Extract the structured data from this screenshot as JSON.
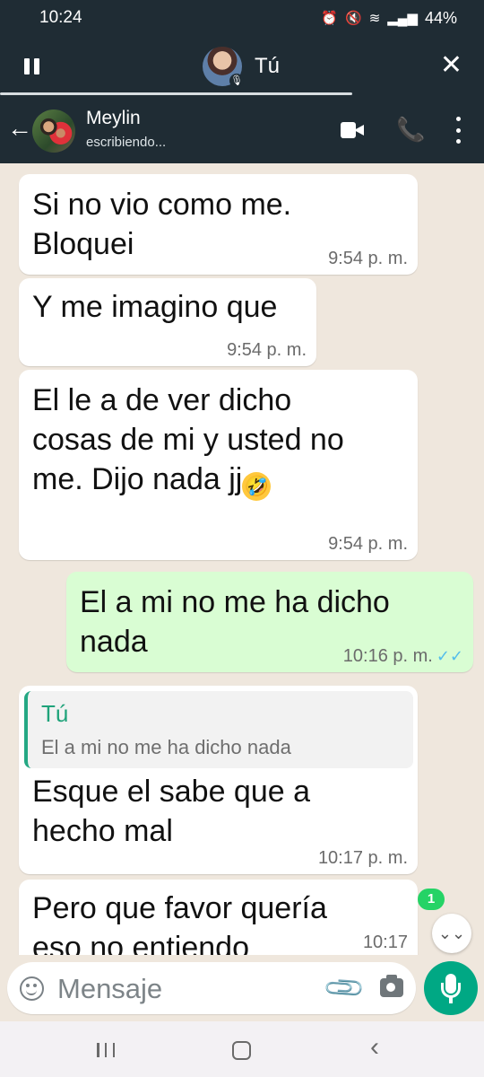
{
  "status_bar": {
    "time": "10:24",
    "icons": [
      "alarm-icon",
      "mute-icon",
      "wifi-icon",
      "signal-icon"
    ],
    "battery": "44%"
  },
  "call_bar": {
    "participant": "Tú",
    "icons": [
      "pause-icon",
      "mic-icon",
      "close-icon"
    ]
  },
  "chat_header": {
    "contact_name": "Meylin",
    "status": "escribiendo...",
    "icons": [
      "back-arrow-icon",
      "video-call-icon",
      "phone-icon",
      "more-menu-icon"
    ]
  },
  "messages": [
    {
      "direction": "in",
      "lines": [
        "Si no vio como me.",
        "Bloquei"
      ],
      "time": "9:54 p. m."
    },
    {
      "direction": "in",
      "lines": [
        "Y me imagino que"
      ],
      "time": "9:54 p. m."
    },
    {
      "direction": "in",
      "lines": [
        "El le a de ver dicho",
        "cosas de mi y usted no",
        "me. Dijo nada jj"
      ],
      "emoji": "🤣",
      "time": "9:54 p. m."
    },
    {
      "direction": "out",
      "lines": [
        "El a mi no me ha dicho",
        "nada"
      ],
      "time": "10:16 p. m.",
      "ticks": "✓✓"
    },
    {
      "direction": "in",
      "quote": {
        "author": "Tú",
        "text": "El a mi no me ha dicho nada"
      },
      "lines": [
        "Esque el sabe que a",
        "hecho mal"
      ],
      "time": "10:17 p. m."
    },
    {
      "direction": "in",
      "lines": [
        "Pero que favor quería",
        "eso no entiendo"
      ],
      "time": "10:17"
    }
  ],
  "unread_count": "1",
  "composer": {
    "placeholder": "Mensaje",
    "icons": [
      "emoji-icon",
      "attach-icon",
      "camera-icon",
      "mic-icon"
    ]
  },
  "colors": {
    "header": "#1f2c34",
    "chat_background": "#efe7dd",
    "outgoing_bubble": "#d9fdd3",
    "accent": "#00a884",
    "read_ticks": "#53bdeb"
  }
}
